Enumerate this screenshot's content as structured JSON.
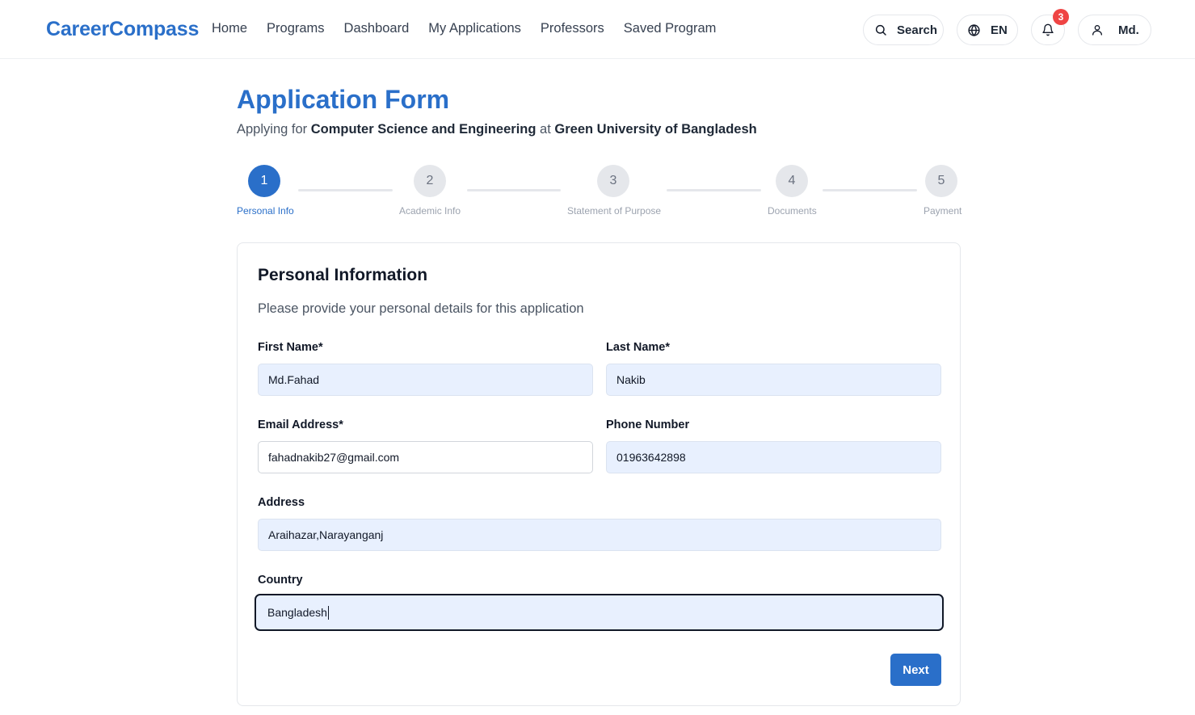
{
  "brand": {
    "logo": "CareerCompass",
    "accent": "#2a6fc9"
  },
  "nav": {
    "items": [
      {
        "label": "Home"
      },
      {
        "label": "Programs"
      },
      {
        "label": "Dashboard"
      },
      {
        "label": "My Applications"
      },
      {
        "label": "Professors"
      },
      {
        "label": "Saved Program"
      }
    ]
  },
  "header": {
    "search_label": "Search",
    "language": "EN",
    "notification_count": "3",
    "user_label": "Md."
  },
  "page": {
    "title": "Application Form",
    "subtitle_prefix": "Applying for ",
    "program": "Computer Science and Engineering",
    "subtitle_mid": " at ",
    "university": "Green University of Bangladesh"
  },
  "stepper": {
    "current_step": 1,
    "steps": [
      {
        "number": "1",
        "label": "Personal Info"
      },
      {
        "number": "2",
        "label": "Academic Info"
      },
      {
        "number": "3",
        "label": "Statement of Purpose"
      },
      {
        "number": "4",
        "label": "Documents"
      },
      {
        "number": "5",
        "label": "Payment"
      }
    ]
  },
  "form": {
    "title": "Personal Information",
    "description": "Please provide your personal details for this application",
    "fields": {
      "first_name": {
        "label": "First Name*",
        "value": "Md.Fahad"
      },
      "last_name": {
        "label": "Last Name*",
        "value": "Nakib"
      },
      "email": {
        "label": "Email Address*",
        "value": "fahadnakib27@gmail.com"
      },
      "phone": {
        "label": "Phone Number",
        "value": "01963642898"
      },
      "address": {
        "label": "Address",
        "value": "Araihazar,Narayanganj"
      },
      "country": {
        "label": "Country",
        "value": "Bangladesh"
      }
    },
    "next_label": "Next"
  }
}
